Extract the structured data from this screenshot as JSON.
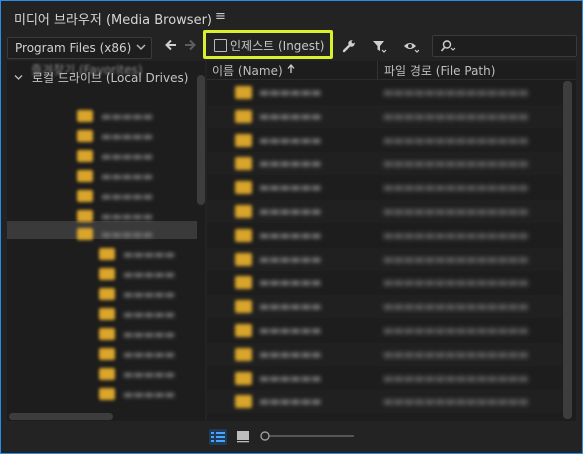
{
  "panel": {
    "title": "미디어 브라우저 (Media Browser)",
    "menu_icon": "hamburger-icon",
    "menu_glyph": "≡"
  },
  "toolbar": {
    "location": "Program Files (x86)",
    "ingest_label": "인제스트 (Ingest)",
    "ingest_checked": false,
    "icons": [
      "back-arrow-icon",
      "forward-arrow-icon",
      "wrench-icon",
      "filter-icon",
      "eye-icon",
      "search-icon"
    ]
  },
  "tree": {
    "partial_label": "즐겨찾기 (Favorites)",
    "local_drives_label": "로컬 드라이브 (Local Drives)"
  },
  "list": {
    "columns": {
      "name": "이름 (Name)",
      "path": "파일 경로 (File Path)"
    },
    "sort": "ascending"
  },
  "colors": {
    "accent_border": "#2d8ceb",
    "highlight": "#d9f02a",
    "folder": "#d9a52b"
  }
}
